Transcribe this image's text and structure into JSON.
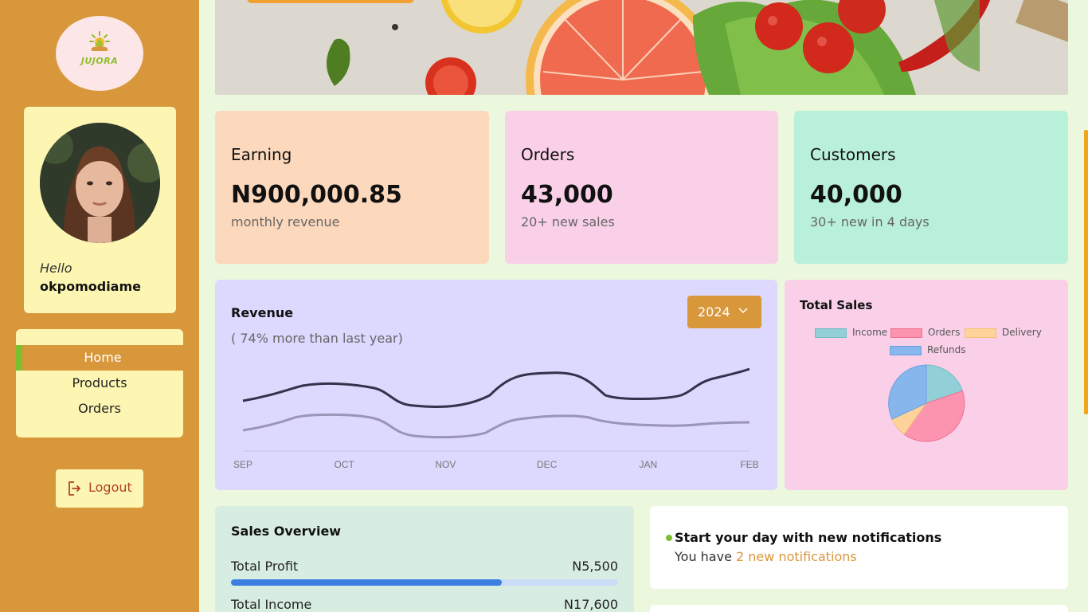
{
  "brand": {
    "name": "JUJORA"
  },
  "profile": {
    "greeting": "Hello",
    "username": "okpomodiame"
  },
  "nav": {
    "items": [
      {
        "label": "Home",
        "active": true
      },
      {
        "label": "Products"
      },
      {
        "label": "Orders"
      }
    ]
  },
  "logout": {
    "label": "Logout",
    "icon": "logout-icon"
  },
  "stats": [
    {
      "title": "Earning",
      "value": "N900,000.85",
      "sub": "monthly revenue",
      "color": "#fcd8bd"
    },
    {
      "title": "Orders",
      "value": "43,000",
      "sub": "20+ new sales",
      "color": "#f9d0e8"
    },
    {
      "title": "Customers",
      "value": "40,000",
      "sub": "30+ new in 4 days",
      "color": "#b9f0da"
    }
  ],
  "revenue": {
    "title": "Revenue",
    "subtitle": "( 74% more than last year)",
    "year": "2024",
    "months": [
      "SEP",
      "OCT",
      "NOV",
      "DEC",
      "JAN",
      "FEB"
    ]
  },
  "total_sales": {
    "title": "Total Sales",
    "legend": [
      {
        "label": "Income",
        "color": "#92cfd6"
      },
      {
        "label": "Orders",
        "color": "#fc94b0"
      },
      {
        "label": "Delivery",
        "color": "#fdd39a"
      },
      {
        "label": "Refunds",
        "color": "#86b6ec"
      }
    ]
  },
  "sales_overview": {
    "title": "Sales Overview",
    "rows": [
      {
        "label": "Total Profit",
        "value": "N5,500",
        "progress": 0.7
      },
      {
        "label": "Total Income",
        "value": "N17,600"
      }
    ]
  },
  "notifications": {
    "title": "Start your day with new notifications",
    "text": "You have ",
    "link": "2 new notifications"
  },
  "colors": {
    "sidebar": "#d8973b",
    "accent": "#7cbf2f",
    "background": "#ecf8de"
  }
}
